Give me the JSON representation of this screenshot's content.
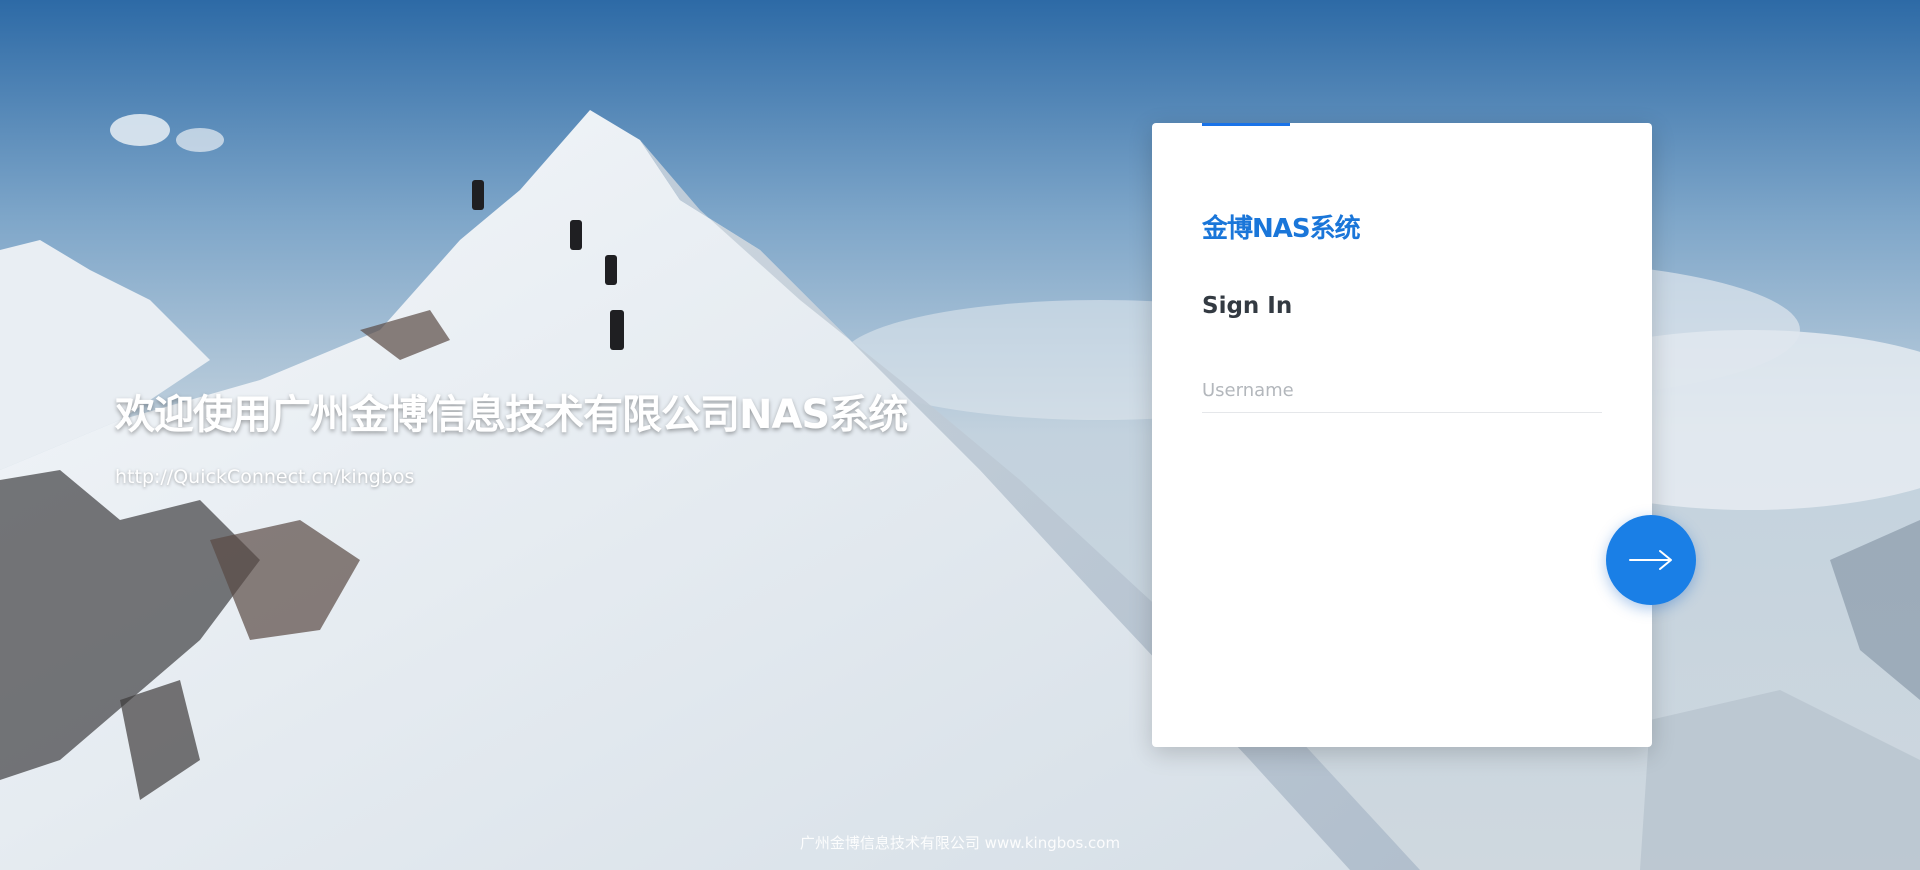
{
  "welcome": {
    "title": "欢迎使用广州金博信息技术有限公司NAS系统",
    "url": "http://QuickConnect.cn/kingbos"
  },
  "login_card": {
    "title": "金博NAS系统",
    "subtitle": "Sign In",
    "username_placeholder": "Username",
    "username_value": "",
    "submit_icon": "arrow-right-icon"
  },
  "footer": {
    "text": "广州金博信息技术有限公司 www.kingbos.com"
  },
  "colors": {
    "accent": "#1a73e8",
    "title_blue": "#1a76d9",
    "submit_button": "#1a7fe6"
  }
}
